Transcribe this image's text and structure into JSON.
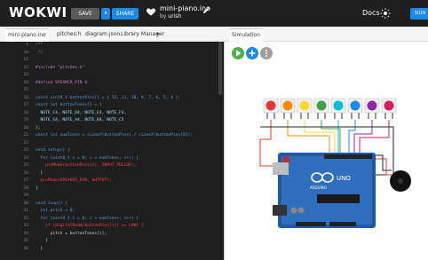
{
  "topbar": {
    "logo": "WOKWI",
    "save_label": "SAVE",
    "dropdown_label": "▾",
    "share_label": "SHARE",
    "project_name": "mini-piano.ino",
    "by_prefix": "by",
    "author": "urish",
    "docs_label": "Docs",
    "signin_label": "SIGN"
  },
  "tabs": [
    {
      "label": "mini-piano.ino"
    },
    {
      "label": "pitches.h"
    },
    {
      "label": "diagram.json"
    },
    {
      "label": "Library Manager"
    },
    {
      "label": "▾"
    }
  ],
  "sim_tab": "Simulation",
  "editor": {
    "lines": [
      {
        "n": "1",
        "t": "/**"
      },
      {
        "n": "10",
        "t": " */"
      },
      {
        "n": "11",
        "t": ""
      },
      {
        "n": "12",
        "t": "#include \"pitches.h\""
      },
      {
        "n": "13",
        "t": ""
      },
      {
        "n": "14",
        "t": "#define SPEAKER_PIN 8"
      },
      {
        "n": "15",
        "t": ""
      },
      {
        "n": "16",
        "t": "const uint8_t buttonPins[] = { 12, 11, 10, 9, 7, 6, 5, 4 };"
      },
      {
        "n": "17",
        "t": "const int buttonTones[] = {"
      },
      {
        "n": "18",
        "t": "  NOTE_C4, NOTE_D4, NOTE_E4, NOTE_F4,"
      },
      {
        "n": "19",
        "t": "  NOTE_G4, NOTE_A4, NOTE_B4, NOTE_C5"
      },
      {
        "n": "20",
        "t": "};"
      },
      {
        "n": "21",
        "t": "const int numTones = sizeof(buttonPins) / sizeof(buttonPins[0]);"
      },
      {
        "n": "22",
        "t": ""
      },
      {
        "n": "23",
        "t": "void setup() {"
      },
      {
        "n": "24",
        "t": "  for (uint8_t i = 0; i < numTones; i++) {"
      },
      {
        "n": "25",
        "t": "    pinMode(buttonPins[i], INPUT_PULLUP);"
      },
      {
        "n": "26",
        "t": "  }"
      },
      {
        "n": "27",
        "t": "  pinMode(SPEAKER_PIN, OUTPUT);"
      },
      {
        "n": "28",
        "t": "}"
      },
      {
        "n": "29",
        "t": ""
      },
      {
        "n": "30",
        "t": "void loop() {"
      },
      {
        "n": "31",
        "t": "  int pitch = 0;"
      },
      {
        "n": "32",
        "t": "  for (uint8_t i = 0; i < numTones; i++) {"
      },
      {
        "n": "33",
        "t": "    if (digitalRead(buttonPins[i]) == LOW) {"
      },
      {
        "n": "34",
        "t": "      pitch = buttonTones[i];"
      },
      {
        "n": "35",
        "t": "    }"
      },
      {
        "n": "36",
        "t": "  }"
      }
    ]
  },
  "simulation": {
    "button_colors": [
      "#e53935",
      "#fb8c00",
      "#fdd835",
      "#43a047",
      "#00bcd4",
      "#1e88e5",
      "#8e24aa",
      "#d81b60"
    ],
    "board_label": "UNO",
    "board_brand": "ARDUINO"
  },
  "colors": {
    "accent": "#1e88e5",
    "topbar": "#1f1f1f",
    "editor_bg": "#1e1e1e",
    "play": "#4caf50"
  }
}
